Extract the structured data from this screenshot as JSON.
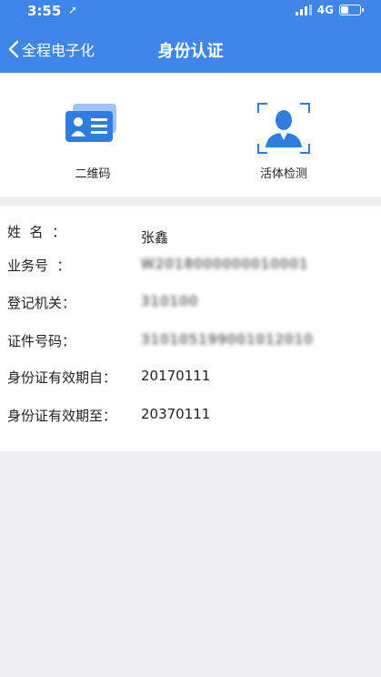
{
  "status_bar": {
    "time": "3:55",
    "network": "4G"
  },
  "nav": {
    "back_label": "全程电子化",
    "title": "身份认证"
  },
  "options": [
    {
      "label": "二维码",
      "icon": "id-card-icon"
    },
    {
      "label": "活体检测",
      "icon": "face-scan-icon"
    }
  ],
  "fields": [
    {
      "key": "姓  名  ：",
      "value": "张鑫"
    },
    {
      "key": "业务号  ：",
      "value": "W2018000000010001"
    },
    {
      "key": "登记机关：",
      "value": "310100"
    },
    {
      "key": "证件号码：",
      "value": "310105199001012010"
    },
    {
      "key": "身份证有效期自：",
      "value": "20170111"
    },
    {
      "key": "身份证有效期至：",
      "value": "20370111"
    }
  ],
  "colors": {
    "header": "#3f86e8",
    "icon": "#2f7de0",
    "background": "#efeff4"
  }
}
